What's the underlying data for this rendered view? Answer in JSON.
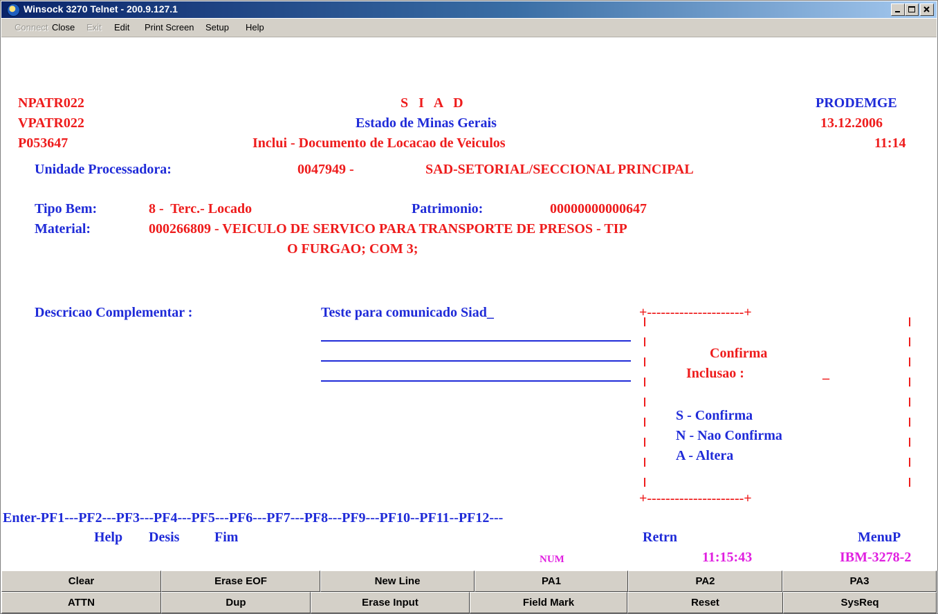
{
  "window": {
    "title": "Winsock 3270 Telnet - 200.9.127.1"
  },
  "menu": [
    "Connect",
    "Close",
    "Exit",
    "Edit",
    "Print Screen",
    "Setup",
    "Help"
  ],
  "screen": {
    "program_id": "NPATR022",
    "screen_id": "VPATR022",
    "user_id": "P053647",
    "system_name": "S   I   A   D",
    "state_name": "Estado de Minas Gerais",
    "function_title": "Inclui - Documento de Locacao de Veiculos",
    "org": "PRODEMGE",
    "date": "13.12.2006",
    "time": "11:14",
    "unidade_label": "Unidade Processadora:",
    "unidade_code": "0047949 -",
    "unidade_name": "SAD-SETORIAL/SECCIONAL PRINCIPAL",
    "tipo_bem_label": "Tipo Bem:",
    "tipo_bem_value": "8 -  Terc.- Locado",
    "patrimonio_label": "Patrimonio:",
    "patrimonio_value": "00000000000647",
    "material_label": "Material:",
    "material_value_line1": "000266809 - VEICULO DE SERVICO PARA TRANSPORTE DE PRESOS - TIP",
    "material_value_line2": "O FURGAO; COM 3;",
    "descricao_label": "Descricao Complementar :",
    "descricao_value": "Teste para comunicado Siad_"
  },
  "confirm_box": {
    "border_top": "+---------------------+",
    "border_bottom": "+---------------------+",
    "title": "Confirma",
    "prompt": "Inclusao :",
    "cursor": "_",
    "options": [
      "S - Confirma",
      "N - Nao Confirma",
      "A - Altera"
    ]
  },
  "function_keys": {
    "line": "Enter-PF1---PF2---PF3---PF4---PF5---PF6---PF7---PF8---PF9---PF10--PF11--PF12---",
    "help": "Help",
    "desis": "Desis",
    "fim": "Fim",
    "retrn": "Retrn",
    "menup": "MenuP"
  },
  "status": {
    "num": "NUM",
    "clock": "11:15:43",
    "terminal": "IBM-3278-2"
  },
  "keypad_row1": [
    "Clear",
    "Erase EOF",
    "New Line",
    "PA1",
    "PA2",
    "PA3"
  ],
  "keypad_row2": [
    "ATTN",
    "Dup",
    "Erase Input",
    "Field Mark",
    "Reset",
    "SysReq"
  ],
  "colors": {
    "field_red": "#ee1c1c",
    "label_blue": "#1f2bd8",
    "status_magenta": "#e020e0",
    "title_bar": "#0a246a"
  }
}
